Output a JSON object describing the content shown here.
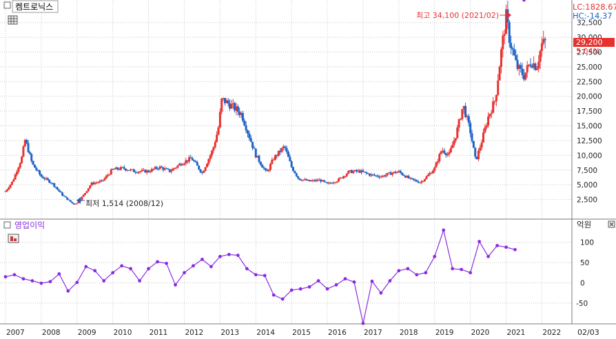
{
  "header": {
    "stock_name": "켐트로닉스",
    "lc_label": "LC:1828.67",
    "hc_label": "HC:-14.37",
    "last_price_label": "29,200",
    "change_label": "5.04%",
    "sub_title": "영업이익",
    "sub_unit": "억원",
    "corner_label": "02/03",
    "max_annotation": "최고 34,100 (2021/02)",
    "min_annotation": "최저 1,514 (2008/12)"
  },
  "colors": {
    "up": "#e8312f",
    "down": "#1f63c6",
    "line": "#8a2be2",
    "grid": "#c7c7c7",
    "price_box": "#e8312f",
    "lc_text": "#e8312f",
    "hc_text": "#1f63c6"
  },
  "icons": [
    "grid-menu-icon",
    "bar-menu-icon",
    "close-icon"
  ],
  "chart_data": [
    {
      "type": "candlestick",
      "title": "켐트로닉스",
      "ylim": [
        0,
        35000
      ],
      "y_ticks": [
        {
          "v": 2500,
          "label": "2,500"
        },
        {
          "v": 5000,
          "label": "5,000"
        },
        {
          "v": 7500,
          "label": "7,500"
        },
        {
          "v": 10000,
          "label": "10,000"
        },
        {
          "v": 12500,
          "label": "12,500"
        },
        {
          "v": 15000,
          "label": "15,000"
        },
        {
          "v": 17500,
          "label": "17,500"
        },
        {
          "v": 20000,
          "label": "20,000"
        },
        {
          "v": 22500,
          "label": "22,500"
        },
        {
          "v": 25000,
          "label": "25,000"
        },
        {
          "v": 27500,
          "label": "27,500"
        },
        {
          "v": 30000,
          "label": "30,000"
        },
        {
          "v": 32500,
          "label": "32,500"
        }
      ],
      "x_labels": [
        "2007",
        "2008",
        "2009",
        "2010",
        "2011",
        "2012",
        "2013",
        "2014",
        "2015",
        "2016",
        "2017",
        "2018",
        "2019",
        "2020",
        "2021",
        "2022"
      ],
      "x_range": [
        2007.0,
        2022.3
      ],
      "close_series": [
        {
          "t": 2007.0,
          "c": 3900
        },
        {
          "t": 2007.2,
          "c": 5600
        },
        {
          "t": 2007.45,
          "c": 9500
        },
        {
          "t": 2007.55,
          "c": 12700
        },
        {
          "t": 2007.75,
          "c": 8500
        },
        {
          "t": 2008.0,
          "c": 6400
        },
        {
          "t": 2008.3,
          "c": 5300
        },
        {
          "t": 2008.6,
          "c": 3200
        },
        {
          "t": 2008.9,
          "c": 1700
        },
        {
          "t": 2009.0,
          "c": 1900
        },
        {
          "t": 2009.2,
          "c": 3400
        },
        {
          "t": 2009.4,
          "c": 5200
        },
        {
          "t": 2009.7,
          "c": 5600
        },
        {
          "t": 2010.0,
          "c": 7600
        },
        {
          "t": 2010.3,
          "c": 7800
        },
        {
          "t": 2010.6,
          "c": 7300
        },
        {
          "t": 2011.0,
          "c": 7300
        },
        {
          "t": 2011.3,
          "c": 8000
        },
        {
          "t": 2011.6,
          "c": 7300
        },
        {
          "t": 2011.9,
          "c": 8600
        },
        {
          "t": 2012.2,
          "c": 9500
        },
        {
          "t": 2012.5,
          "c": 7000
        },
        {
          "t": 2012.8,
          "c": 11000
        },
        {
          "t": 2012.95,
          "c": 14500
        },
        {
          "t": 2013.05,
          "c": 19500
        },
        {
          "t": 2013.3,
          "c": 18500
        },
        {
          "t": 2013.6,
          "c": 17000
        },
        {
          "t": 2013.8,
          "c": 13500
        },
        {
          "t": 2014.0,
          "c": 10000
        },
        {
          "t": 2014.3,
          "c": 7000
        },
        {
          "t": 2014.5,
          "c": 9500
        },
        {
          "t": 2014.8,
          "c": 11500
        },
        {
          "t": 2015.0,
          "c": 8000
        },
        {
          "t": 2015.2,
          "c": 6000
        },
        {
          "t": 2015.5,
          "c": 5600
        },
        {
          "t": 2015.8,
          "c": 5800
        },
        {
          "t": 2016.0,
          "c": 5100
        },
        {
          "t": 2016.3,
          "c": 5800
        },
        {
          "t": 2016.6,
          "c": 7200
        },
        {
          "t": 2016.9,
          "c": 7300
        },
        {
          "t": 2017.2,
          "c": 6700
        },
        {
          "t": 2017.5,
          "c": 6400
        },
        {
          "t": 2017.8,
          "c": 7000
        },
        {
          "t": 2018.0,
          "c": 7200
        },
        {
          "t": 2018.3,
          "c": 6000
        },
        {
          "t": 2018.6,
          "c": 5400
        },
        {
          "t": 2018.8,
          "c": 6500
        },
        {
          "t": 2019.0,
          "c": 7800
        },
        {
          "t": 2019.2,
          "c": 11000
        },
        {
          "t": 2019.4,
          "c": 10000
        },
        {
          "t": 2019.6,
          "c": 13500
        },
        {
          "t": 2019.8,
          "c": 18500
        },
        {
          "t": 2020.0,
          "c": 14000
        },
        {
          "t": 2020.15,
          "c": 9000
        },
        {
          "t": 2020.3,
          "c": 12000
        },
        {
          "t": 2020.5,
          "c": 16500
        },
        {
          "t": 2020.7,
          "c": 19500
        },
        {
          "t": 2020.85,
          "c": 27000
        },
        {
          "t": 2021.0,
          "c": 33500
        },
        {
          "t": 2021.1,
          "c": 29500
        },
        {
          "t": 2021.3,
          "c": 25000
        },
        {
          "t": 2021.5,
          "c": 23500
        },
        {
          "t": 2021.7,
          "c": 26000
        },
        {
          "t": 2021.85,
          "c": 25000
        },
        {
          "t": 2022.0,
          "c": 28800
        },
        {
          "t": 2022.1,
          "c": 29200
        }
      ],
      "last_price": 29200,
      "max_point": {
        "t": 2021.05,
        "v": 34100
      },
      "min_point": {
        "t": 2008.9,
        "v": 1514
      }
    },
    {
      "type": "line",
      "title": "영업이익",
      "ylabel": "억원",
      "ylim": [
        -100,
        135
      ],
      "y_ticks": [
        {
          "v": 100,
          "label": "100"
        },
        {
          "v": 50,
          "label": "50"
        },
        {
          "v": 0,
          "label": "0"
        },
        {
          "v": -50,
          "label": "-50"
        }
      ],
      "x": [
        2007.0,
        2007.25,
        2007.5,
        2007.75,
        2008.0,
        2008.25,
        2008.5,
        2008.75,
        2009.0,
        2009.25,
        2009.5,
        2009.75,
        2010.0,
        2010.25,
        2010.5,
        2010.75,
        2011.0,
        2011.25,
        2011.5,
        2011.75,
        2012.0,
        2012.25,
        2012.5,
        2012.75,
        2013.0,
        2013.25,
        2013.5,
        2013.75,
        2014.0,
        2014.25,
        2014.5,
        2014.75,
        2015.0,
        2015.25,
        2015.5,
        2015.75,
        2016.0,
        2016.25,
        2016.5,
        2016.75,
        2017.0,
        2017.25,
        2017.5,
        2017.75,
        2018.0,
        2018.25,
        2018.5,
        2018.75,
        2019.0,
        2019.25,
        2019.5,
        2019.75,
        2020.0,
        2020.25,
        2020.5,
        2020.75,
        2021.0,
        2021.25,
        2021.5
      ],
      "values": [
        15,
        20,
        10,
        5,
        -1,
        3,
        22,
        -20,
        1,
        40,
        30,
        5,
        25,
        42,
        35,
        5,
        35,
        52,
        48,
        -5,
        25,
        42,
        58,
        40,
        65,
        70,
        68,
        35,
        20,
        18,
        -30,
        -40,
        -18,
        -15,
        -10,
        5,
        -15,
        -5,
        10,
        2,
        -100,
        4,
        -25,
        5,
        30,
        35,
        20,
        25,
        65,
        130,
        35,
        33,
        25,
        102,
        65,
        92,
        88,
        82
      ]
    }
  ]
}
